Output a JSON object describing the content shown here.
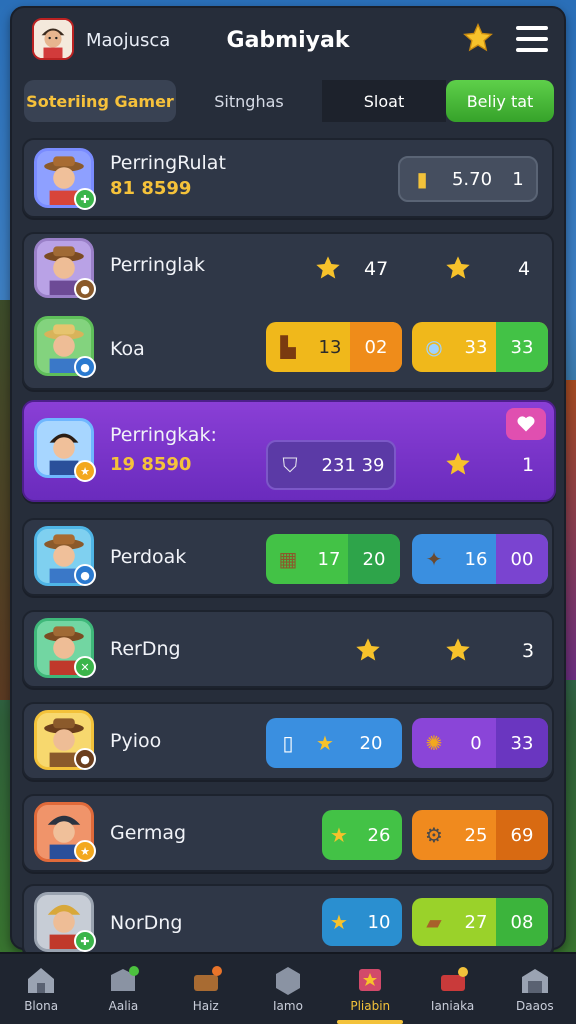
{
  "header": {
    "username": "Maojusca",
    "title": "Gabmiyak"
  },
  "tabs": [
    {
      "label": "Soteriing Gamer"
    },
    {
      "label": "Sitnghas"
    },
    {
      "label": "Sloat"
    },
    {
      "label": "Beliy tat"
    }
  ],
  "rows": [
    {
      "name": "PerringRulat",
      "score": "81 8599",
      "pill_value": "5.70",
      "pill_extra": "1"
    },
    {
      "name": "Perringlak",
      "mid_text": "47",
      "right_num": "4"
    },
    {
      "name": "Koa",
      "pill1_a": "13",
      "pill1_b": "02",
      "pill2_a": "33",
      "pill2_b": "33"
    },
    {
      "name": "Perringkak:",
      "score": "19 8590",
      "pill_value": "231 39",
      "right_num": "1"
    },
    {
      "name": "Perdoak",
      "pill1_a": "17",
      "pill1_b": "20",
      "pill2_a": "16",
      "pill2_b": "00"
    },
    {
      "name": "RerDng",
      "right_num": "3"
    },
    {
      "name": "Pyioo",
      "pill1_a": "20",
      "pill2_a": "0",
      "pill2_b": "33"
    },
    {
      "name": "Germag",
      "pill1_a": "26",
      "pill2_a": "25",
      "pill2_b": "69"
    },
    {
      "name": "NorDng",
      "pill1_a": "10",
      "pill2_a": "27",
      "pill2_b": "08"
    }
  ],
  "nav": [
    {
      "label": "Blona"
    },
    {
      "label": "Aalia"
    },
    {
      "label": "Haiz"
    },
    {
      "label": "Iamo"
    },
    {
      "label": "Pliabin"
    },
    {
      "label": "Ianiaka"
    },
    {
      "label": "Daaos"
    }
  ],
  "colors": {
    "panel": "#262d3a",
    "accent_gold": "#f5c23a",
    "highlight_purple": "#7a35cc",
    "tab_green": "#4cc23e"
  }
}
